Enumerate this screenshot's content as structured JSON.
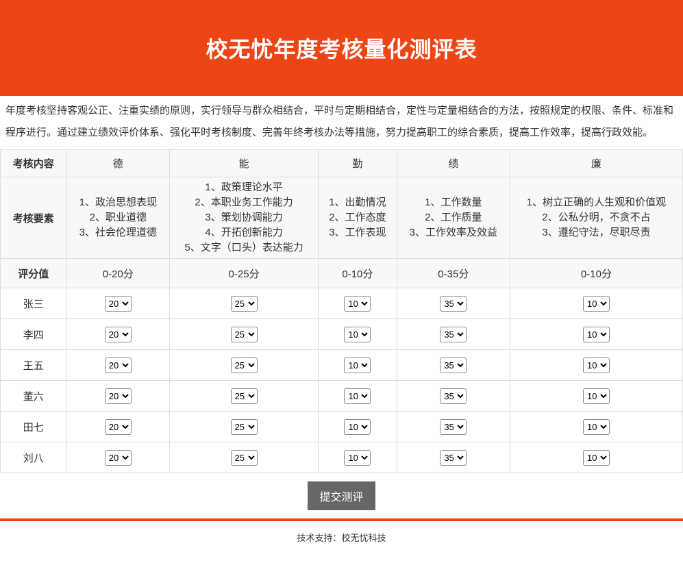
{
  "colors": {
    "accent": "#ee4517",
    "button_bg": "#666666",
    "border": "#dddddd",
    "header_row_bg": "#f8f8f8"
  },
  "header": {
    "title": "校无忧年度考核量化测评表"
  },
  "intro": "年度考核坚持客观公正、注重实绩的原则，实行领导与群众相结合，平时与定期相结合，定性与定量相结合的方法，按照规定的权限、条件、标准和程序进行。通过建立绩效评价体系、强化平时考核制度、完善年终考核办法等措施，努力提高职工的综合素质，提高工作效率，提高行政效能。",
  "table": {
    "row_labels": {
      "content": "考核内容",
      "factors": "考核要素",
      "score": "评分值"
    },
    "columns": [
      {
        "label": "德",
        "range": "0-20分",
        "factors": [
          "1、政治思想表现",
          "2、职业道德",
          "3、社会伦理道德"
        ]
      },
      {
        "label": "能",
        "range": "0-25分",
        "factors": [
          "1、政策理论水平",
          "2、本职业务工作能力",
          "3、策划协调能力",
          "4、开拓创新能力",
          "5、文字（口头）表达能力"
        ]
      },
      {
        "label": "勤",
        "range": "0-10分",
        "factors": [
          "1、出勤情况",
          "2、工作态度",
          "3、工作表现"
        ]
      },
      {
        "label": "绩",
        "range": "0-35分",
        "factors": [
          "1、工作数量",
          "2、工作质量",
          "3、工作效率及效益"
        ]
      },
      {
        "label": "廉",
        "range": "0-10分",
        "factors": [
          "1、树立正确的人生观和价值观",
          "2、公私分明，不贪不占",
          "3、遵纪守法，尽职尽责"
        ]
      }
    ],
    "people": [
      {
        "name": "张三",
        "scores": [
          "20",
          "25",
          "10",
          "35",
          "10"
        ]
      },
      {
        "name": "李四",
        "scores": [
          "20",
          "25",
          "10",
          "35",
          "10"
        ]
      },
      {
        "name": "王五",
        "scores": [
          "20",
          "25",
          "10",
          "35",
          "10"
        ]
      },
      {
        "name": "董六",
        "scores": [
          "20",
          "25",
          "10",
          "35",
          "10"
        ]
      },
      {
        "name": "田七",
        "scores": [
          "20",
          "25",
          "10",
          "35",
          "10"
        ]
      },
      {
        "name": "刘八",
        "scores": [
          "20",
          "25",
          "10",
          "35",
          "10"
        ]
      }
    ]
  },
  "submit": {
    "label": "提交测评"
  },
  "footer": {
    "text": "技术支持：校无忧科技"
  }
}
